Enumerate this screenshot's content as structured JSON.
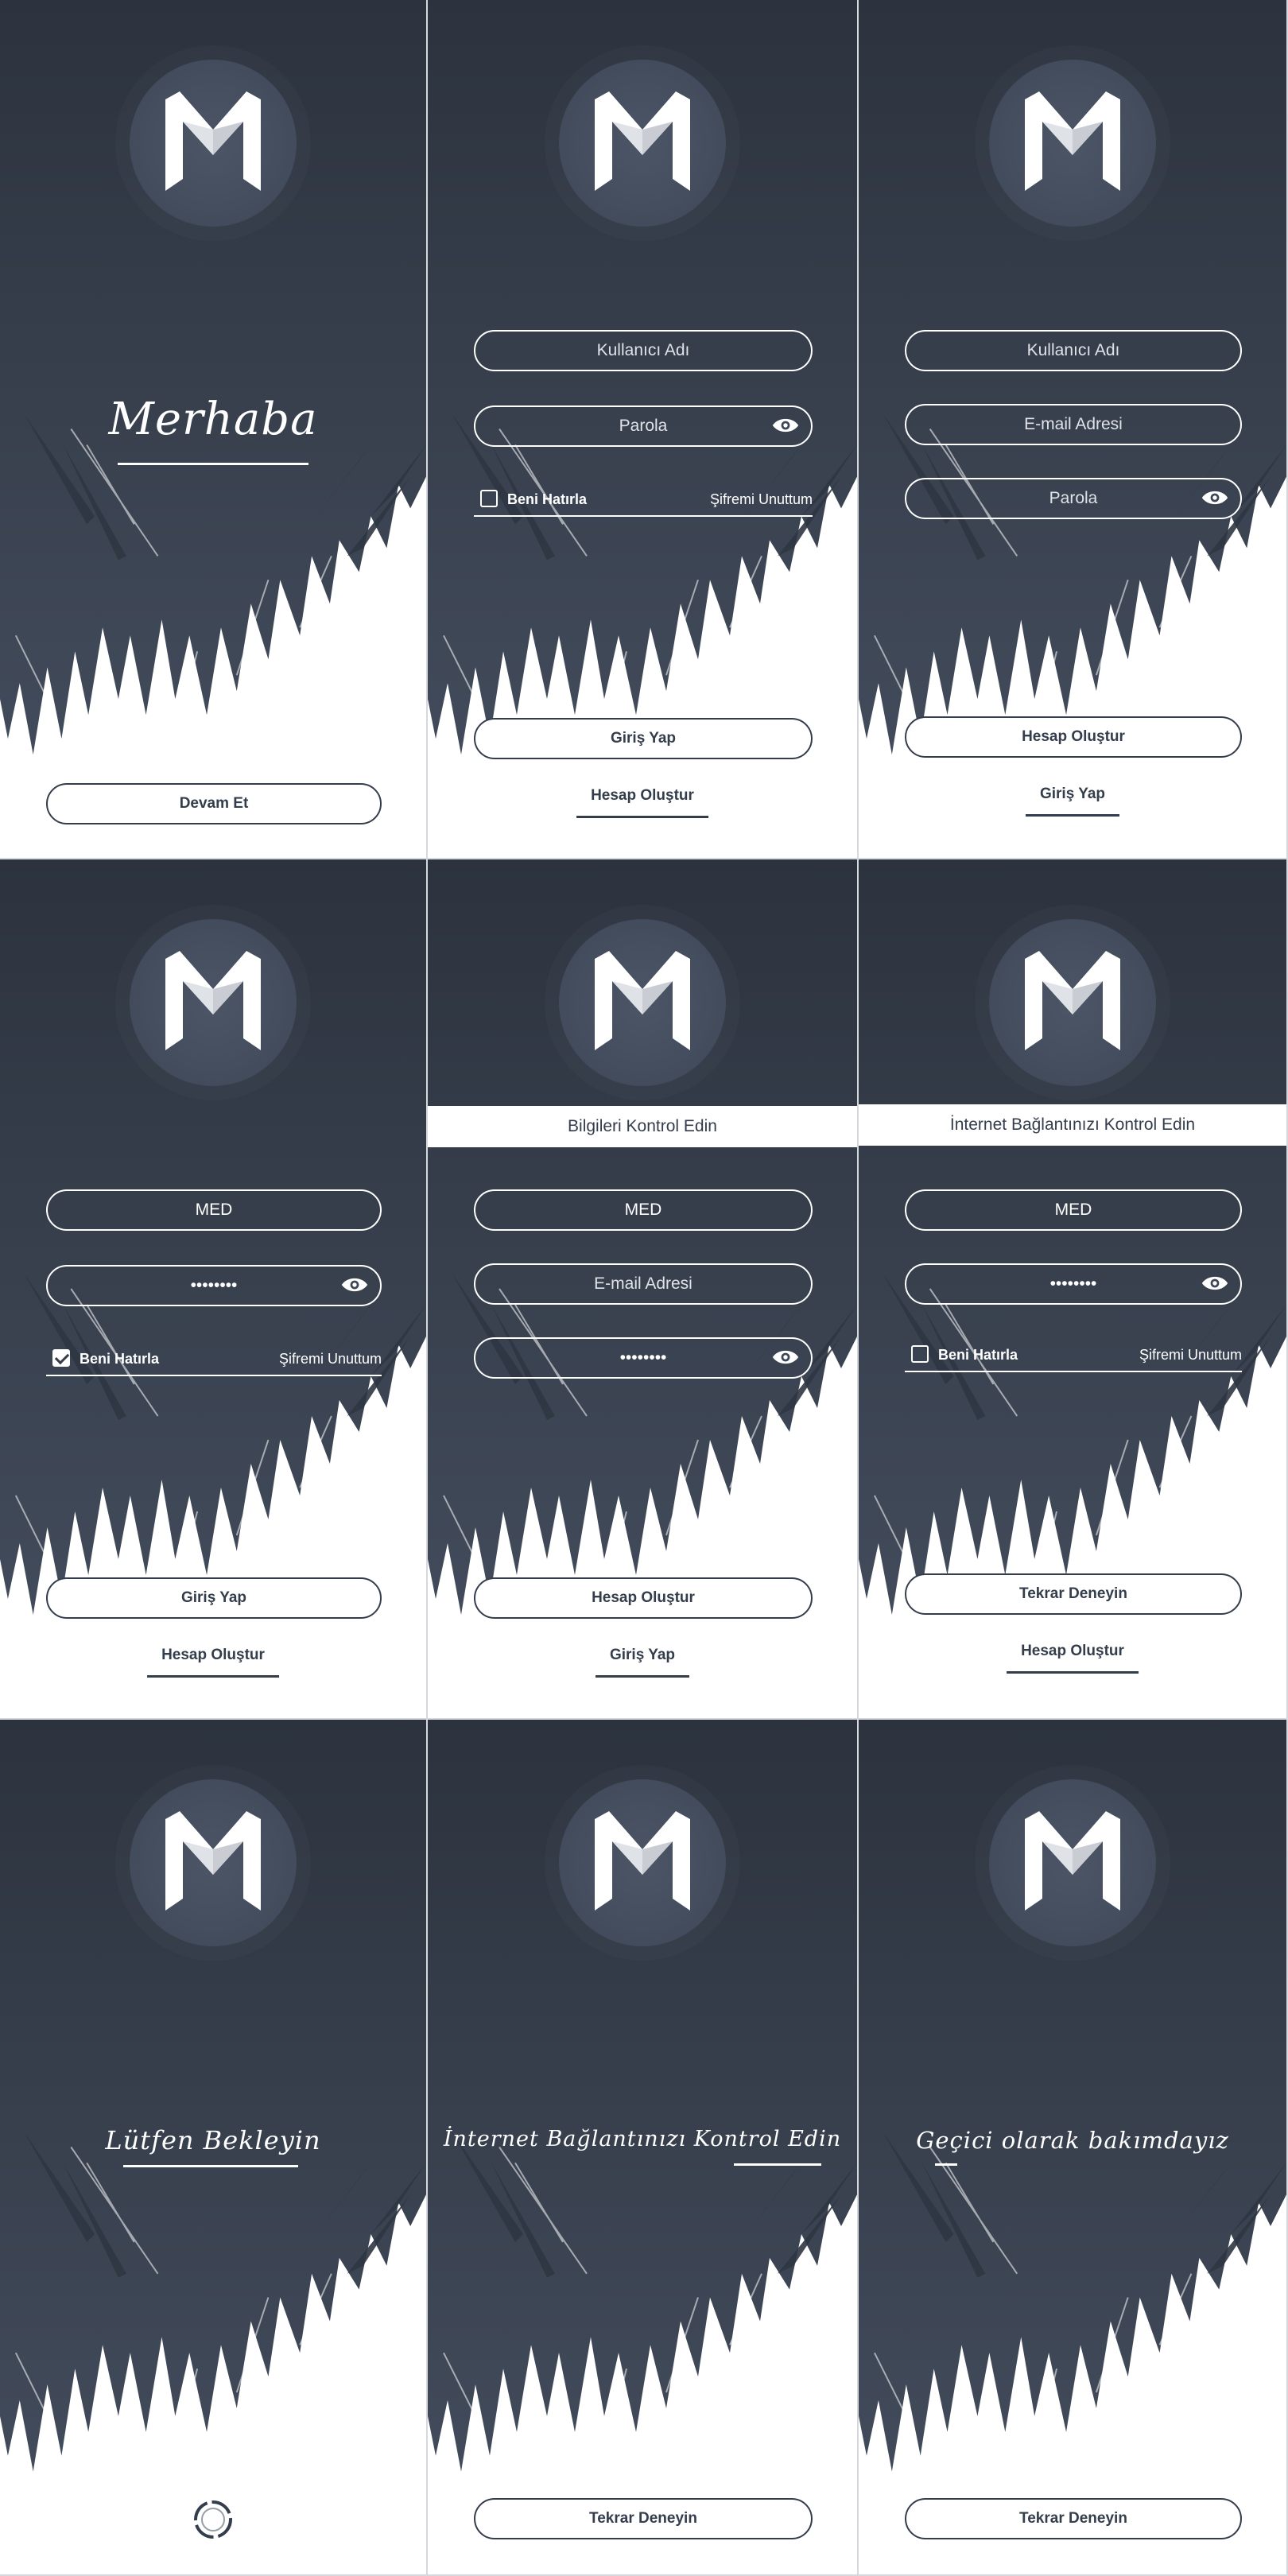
{
  "colors": {
    "dark": "#2d3440",
    "dark_mid": "#3d4656",
    "white": "#ffffff",
    "text": "#333d4b"
  },
  "icons": {
    "logo": "m-logo-icon",
    "eye": "eye-icon",
    "spinner": "loading-spinner-icon",
    "checkbox": "checkbox-icon"
  },
  "screens": {
    "welcome": {
      "title": "Merhaba",
      "button": "Devam Et"
    },
    "login": {
      "username_placeholder": "Kullanıcı Adı",
      "password_placeholder": "Parola",
      "remember": "Beni Hatırla",
      "remember_checked": false,
      "forgot": "Şifremi Unuttum",
      "button": "Giriş Yap",
      "link": "Hesap Oluştur"
    },
    "register": {
      "username_placeholder": "Kullanıcı Adı",
      "email_placeholder": "E-mail Adresi",
      "password_placeholder": "Parola",
      "button": "Hesap Oluştur",
      "link": "Giriş Yap"
    },
    "login_filled": {
      "username_value": "MED",
      "password_value": "••••••••",
      "remember": "Beni Hatırla",
      "remember_checked": true,
      "forgot": "Şifremi Unuttum",
      "button": "Giriş Yap",
      "link": "Hesap Oluştur"
    },
    "register_error": {
      "banner": "Bilgileri Kontrol Edin",
      "username_value": "MED",
      "email_placeholder": "E-mail Adresi",
      "password_value": "••••••••",
      "button": "Hesap Oluştur",
      "link": "Giriş Yap"
    },
    "connection_error_login": {
      "banner": "İnternet Bağlantınızı Kontrol Edin",
      "username_value": "MED",
      "password_value": "••••••••",
      "remember": "Beni Hatırla",
      "remember_checked": false,
      "forgot": "Şifremi Unuttum",
      "button": "Tekrar Deneyin",
      "link": "Hesap Oluştur"
    },
    "loading": {
      "title": "Lütfen Bekleyin"
    },
    "offline": {
      "title": "İnternet Bağlantınızı Kontrol Edin",
      "button": "Tekrar Deneyin"
    },
    "maintenance": {
      "title": "Geçici olarak bakımdayız",
      "button": "Tekrar Deneyin"
    }
  }
}
